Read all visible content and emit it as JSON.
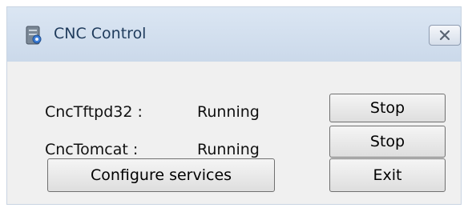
{
  "window": {
    "title": "CNC Control"
  },
  "services": [
    {
      "name": "CncTftpd32 :",
      "status": "Running",
      "action": "Stop"
    },
    {
      "name": "CncTomcat :",
      "status": "Running",
      "action": "Stop"
    }
  ],
  "buttons": {
    "configure": "Configure services",
    "exit": "Exit"
  },
  "icons": {
    "app": "server-gear-icon",
    "close": "close-icon"
  }
}
